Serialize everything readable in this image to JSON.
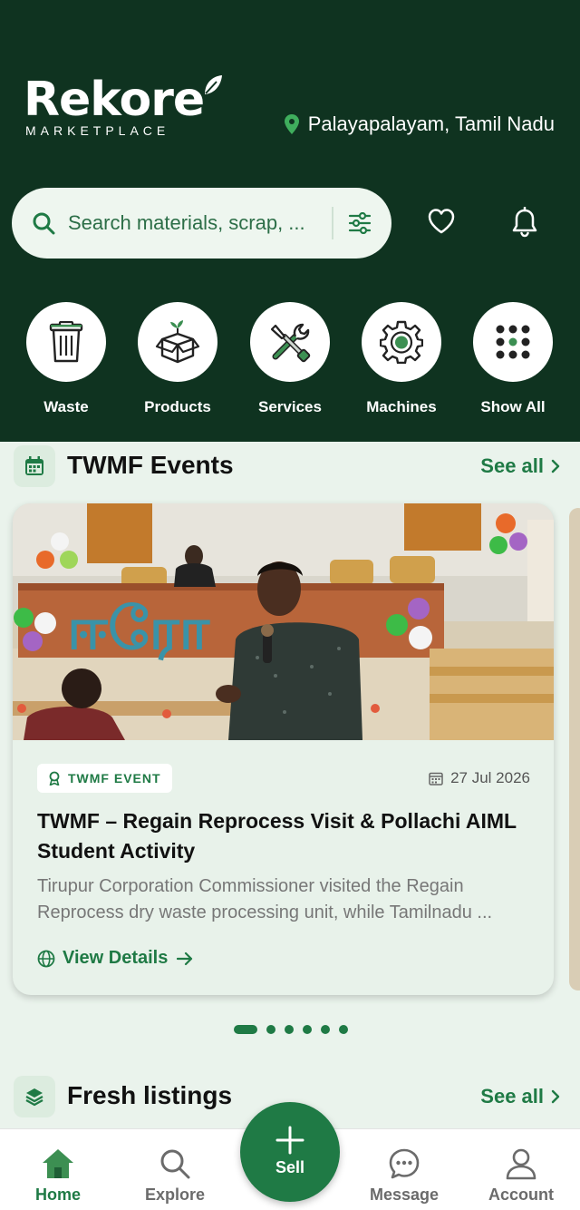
{
  "brand": {
    "name": "Rekore",
    "tagline": "MARKETPLACE"
  },
  "location": {
    "text": "Palayapalayam, Tamil Nadu",
    "icon": "map-pin-icon"
  },
  "search": {
    "placeholder": "Search materials, scrap, ...",
    "icon": "search-icon",
    "filter_icon": "filter-sliders-icon"
  },
  "header_actions": [
    {
      "icon": "heart-icon"
    },
    {
      "icon": "bell-icon"
    }
  ],
  "categories": [
    {
      "label": "Waste",
      "icon": "trash-bin-icon"
    },
    {
      "label": "Products",
      "icon": "box-icon"
    },
    {
      "label": "Services",
      "icon": "tools-icon"
    },
    {
      "label": "Machines",
      "icon": "gear-icon"
    },
    {
      "label": "Show All",
      "icon": "grid-dots-icon"
    }
  ],
  "events_section": {
    "title": "TWMF Events",
    "see_all": "See all",
    "icon": "calendar-icon",
    "card": {
      "badge": "TWMF EVENT",
      "date": "27 Jul 2026",
      "title": "TWMF – Regain Reprocess Visit & Pollachi AIML Student Activity",
      "description": "Tirupur Corporation Commissioner visited the Regain Reprocess dry waste processing unit, while Tamilnadu ...",
      "cta": "View Details",
      "photo_signage": "ஈரோ"
    },
    "carousel": {
      "count": 6,
      "active": 1
    }
  },
  "listings_section": {
    "title": "Fresh listings",
    "see_all": "See all",
    "icon": "layers-icon"
  },
  "bottom_nav": {
    "items": [
      {
        "label": "Home",
        "icon": "home-icon",
        "active": true
      },
      {
        "label": "Explore",
        "icon": "search-icon",
        "active": false
      },
      {
        "label": "Message",
        "icon": "chat-bubble-icon",
        "active": false
      },
      {
        "label": "Account",
        "icon": "user-icon",
        "active": false
      }
    ],
    "sell": {
      "label": "Sell",
      "icon": "plus-icon"
    }
  },
  "colors": {
    "primary": "#1f7a45",
    "header_bg": "#0f3320",
    "page_bg": "#eaf3ec"
  }
}
